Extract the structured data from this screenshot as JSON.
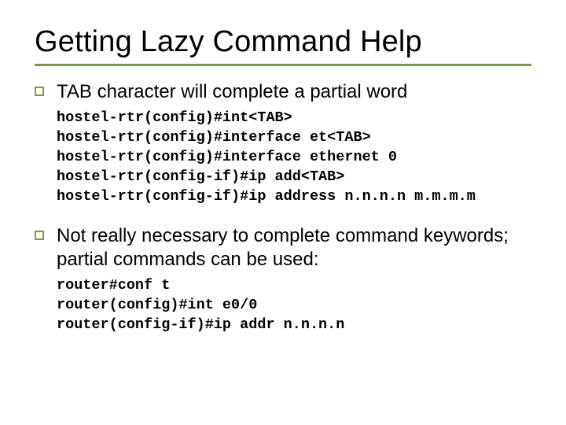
{
  "title": "Getting Lazy Command Help",
  "bullets": [
    {
      "text": "TAB character will complete a partial word",
      "code": "hostel-rtr(config)#int<TAB>\nhostel-rtr(config)#interface et<TAB>\nhostel-rtr(config)#interface ethernet 0\nhostel-rtr(config-if)#ip add<TAB>\nhostel-rtr(config-if)#ip address n.n.n.n m.m.m.m"
    },
    {
      "text": "Not really necessary to complete command keywords; partial commands can be used:",
      "code": "router#conf t\nrouter(config)#int e0/0\nrouter(config-if)#ip addr n.n.n.n"
    }
  ]
}
